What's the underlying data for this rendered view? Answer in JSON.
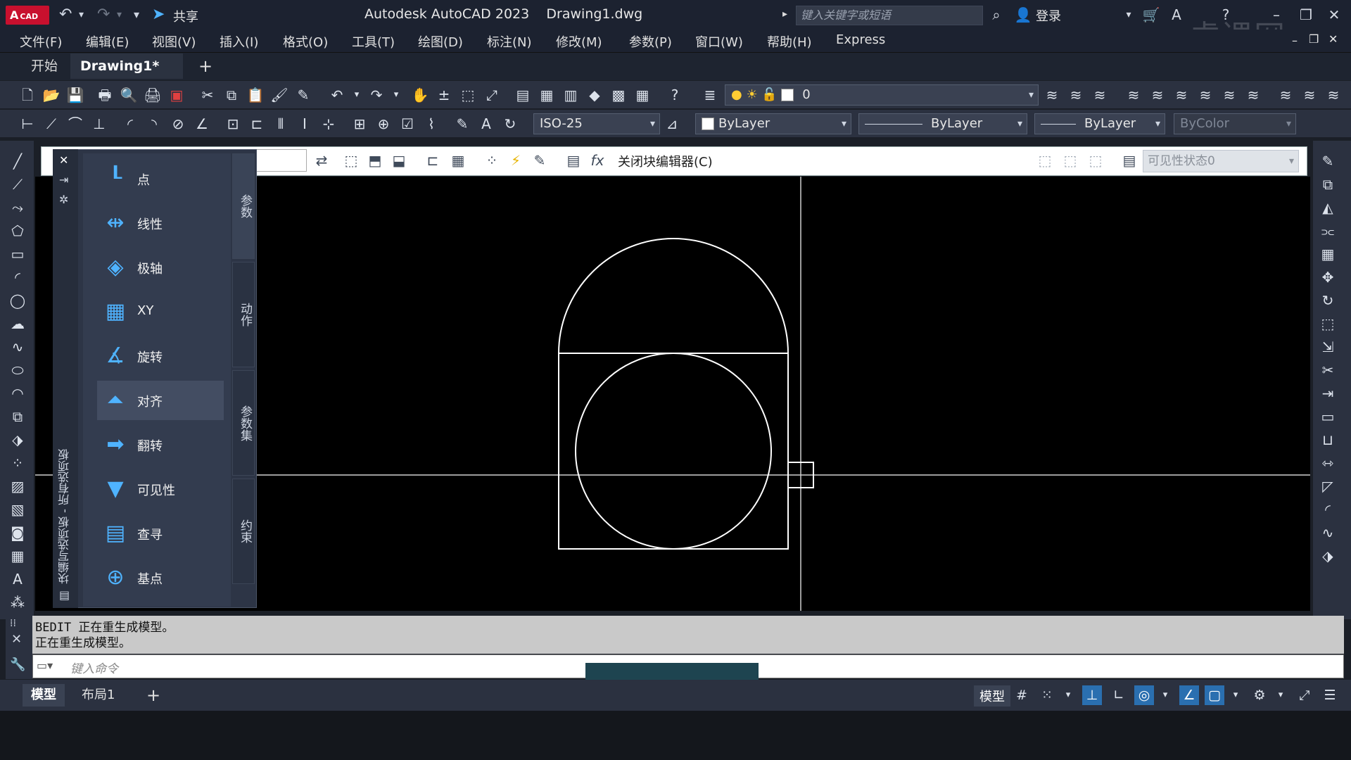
{
  "title_bar": {
    "logo_text": "A",
    "logo_sub": "CAD",
    "share_label": "共享",
    "app_title": "Autodesk AutoCAD 2023",
    "file_name": "Drawing1.dwg",
    "search_placeholder": "键入关键字或短语",
    "login_label": "登录",
    "watermark": "虎课网"
  },
  "menu": [
    "文件(F)",
    "编辑(E)",
    "视图(V)",
    "插入(I)",
    "格式(O)",
    "工具(T)",
    "绘图(D)",
    "标注(N)",
    "修改(M)",
    "参数(P)",
    "窗口(W)",
    "帮助(H)",
    "Express"
  ],
  "file_tabs": {
    "start": "开始",
    "drawing": "Drawing1*",
    "close": "×",
    "add": "+"
  },
  "toolbar1": {
    "layer_value": "0"
  },
  "toolbar2": {
    "dim_style": "ISO-25",
    "color": "ByLayer",
    "linetype": "ByLayer",
    "lineweight": "ByLayer",
    "plot_style": "ByColor"
  },
  "block_editor": {
    "close_label": "关闭块编辑器(C)",
    "visibility_state": "可见性状态0",
    "fx": "fx"
  },
  "palette": {
    "title": "块编写选项板 - 所有选项板",
    "items": [
      "点",
      "线性",
      "极轴",
      "XY",
      "旋转",
      "对齐",
      "翻转",
      "可见性",
      "查寻",
      "基点"
    ],
    "selected_index": 5,
    "tabs": [
      "参数",
      "动作",
      "参数集",
      "约束"
    ]
  },
  "command": {
    "history_line1": "BEDIT 正在重生成模型。",
    "history_line2": "正在重生成模型。",
    "placeholder": "键入命令"
  },
  "status": {
    "layout_model": "模型",
    "layout_1": "布局1",
    "layout_add": "+",
    "model_space": "模型"
  }
}
